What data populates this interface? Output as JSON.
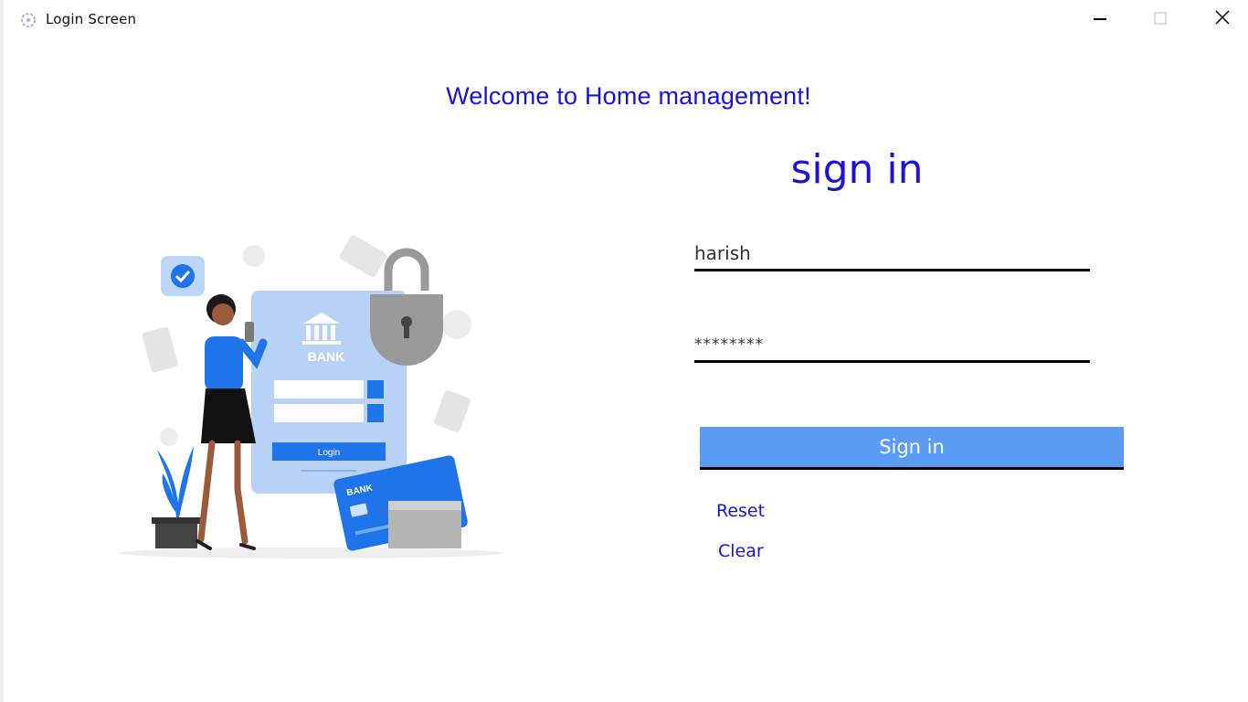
{
  "window": {
    "title": "Login Screen",
    "icon": "app-logo-icon",
    "controls": [
      "minimize-icon",
      "maximize-icon",
      "close-icon"
    ]
  },
  "welcome_text": "Welcome to Home management!",
  "signin_heading": "sign in",
  "form": {
    "username_value": "harish",
    "password_value": "********",
    "signin_button_label": "Sign in",
    "reset_label": "Reset",
    "clear_label": "Clear"
  },
  "illustration": {
    "bank_label": "BANK",
    "login_button_label": "Login",
    "card_label": "BANK"
  },
  "colors": {
    "accent_text": "#1a12d8",
    "button_bg": "#5a9cf2",
    "illustration_blue": "#1e74e8"
  }
}
